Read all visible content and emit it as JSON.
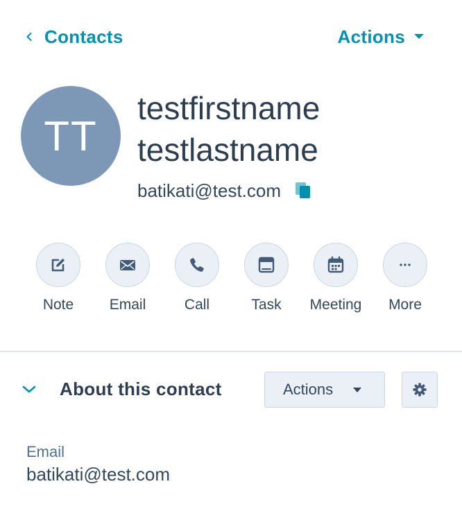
{
  "header": {
    "back_label": "Contacts",
    "actions_label": "Actions"
  },
  "contact": {
    "initials": "TT",
    "first_name": "testfirstname",
    "last_name": "testlastname",
    "email": "batikati@test.com"
  },
  "quick_actions": [
    {
      "label": "Note",
      "icon": "note-icon"
    },
    {
      "label": "Email",
      "icon": "email-icon"
    },
    {
      "label": "Call",
      "icon": "call-icon"
    },
    {
      "label": "Task",
      "icon": "task-icon"
    },
    {
      "label": "Meeting",
      "icon": "meeting-icon"
    },
    {
      "label": "More",
      "icon": "more-icon"
    }
  ],
  "about": {
    "title": "About this contact",
    "actions_label": "Actions",
    "properties": [
      {
        "label": "Email",
        "value": "batikati@test.com"
      }
    ]
  },
  "colors": {
    "accent": "#0091ae",
    "avatar_bg": "#7c98b6",
    "button_bg": "#eaf0f6",
    "button_border": "#cbd6e2",
    "text_dark": "#33475b"
  }
}
